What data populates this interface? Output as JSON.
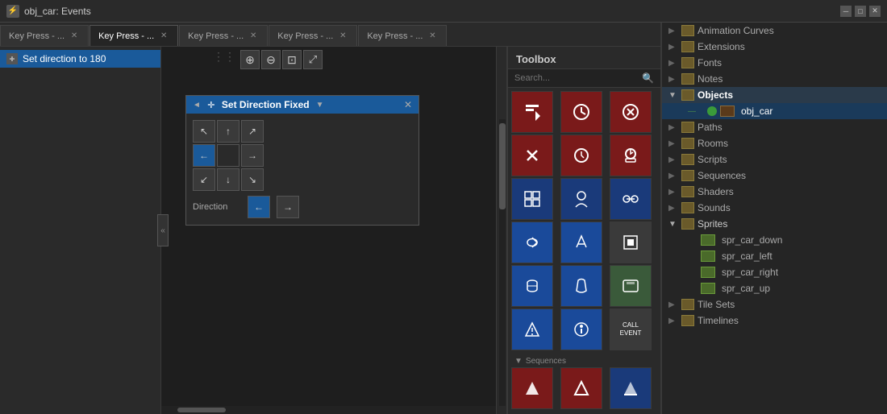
{
  "titleBar": {
    "icon": "⚡",
    "title": "obj_car: Events",
    "minimizeBtn": "─",
    "maximizeBtn": "□",
    "closeBtn": "✕"
  },
  "tabs": [
    {
      "id": 0,
      "label": "Key Press - ...",
      "active": false
    },
    {
      "id": 1,
      "label": "Key Press - ...",
      "active": true
    },
    {
      "id": 2,
      "label": "Key Press - ...",
      "active": false
    },
    {
      "id": 3,
      "label": "Key Press - ...",
      "active": false
    },
    {
      "id": 4,
      "label": "Key Press - ...",
      "active": false
    }
  ],
  "editorToolbar": {
    "dots": "⋮",
    "zoomInLabel": "+",
    "zoomOutLabel": "−",
    "fitLabel": "⊡",
    "fullscreenLabel": "⤢"
  },
  "eventList": [
    {
      "id": 0,
      "label": "Set direction to 180",
      "selected": true,
      "icon": "✛"
    }
  ],
  "canvas": {
    "block": {
      "titleArrow": "◄",
      "titleIcon": "✛",
      "title": "Set Direction Fixed",
      "dropArrow": "▼",
      "closeBtn": "✕",
      "directionLabel": "Direction"
    }
  },
  "toolbox": {
    "title": "Toolbox",
    "searchPlaceholder": "Search...",
    "searchIcon": "🔍",
    "sections": [
      {
        "id": "actions",
        "collapsed": false,
        "tools": [
          {
            "icon": "🚩",
            "color": "dark-red",
            "label": ""
          },
          {
            "icon": "🔄",
            "color": "dark-red",
            "label": ""
          },
          {
            "icon": "⬇",
            "color": "dark-red",
            "label": ""
          },
          {
            "icon": "✂",
            "color": "dark-red",
            "label": ""
          },
          {
            "icon": "⏱",
            "color": "dark-red",
            "label": ""
          },
          {
            "icon": "⏰",
            "color": "dark-red",
            "label": ""
          },
          {
            "icon": "⊞",
            "color": "dark-blue",
            "label": ""
          },
          {
            "icon": "👤",
            "color": "dark-blue",
            "label": ""
          },
          {
            "icon": "⚡",
            "color": "dark-blue",
            "label": ""
          },
          {
            "icon": "➡",
            "color": "medium-blue",
            "label": ""
          },
          {
            "icon": "🐾",
            "color": "medium-blue",
            "label": ""
          },
          {
            "icon": "⬛",
            "color": "gray",
            "label": ""
          },
          {
            "icon": "⚙",
            "color": "medium-blue",
            "label": ""
          },
          {
            "icon": "🐍",
            "color": "medium-blue",
            "label": ""
          },
          {
            "icon": "❓",
            "color": "medium-blue",
            "label": ""
          },
          {
            "icon": "↩",
            "color": "medium-blue",
            "label": ""
          },
          {
            "icon": "⊙",
            "color": "medium-blue",
            "label": ""
          },
          {
            "icon": "CALL\nEVENT",
            "color": "gray",
            "label": "CALL\nEVENT"
          }
        ]
      },
      {
        "id": "sequences",
        "label": "Sequences",
        "collapsed": false,
        "tools": [
          {
            "icon": "▲",
            "color": "dark-red",
            "label": ""
          },
          {
            "icon": "▲",
            "color": "dark-red",
            "label": ""
          },
          {
            "icon": "▲",
            "color": "dark-blue",
            "label": ""
          }
        ]
      }
    ]
  },
  "assetTree": {
    "items": [
      {
        "type": "folder",
        "label": "Animation Curves",
        "indent": 0,
        "expanded": false
      },
      {
        "type": "folder",
        "label": "Extensions",
        "indent": 0,
        "expanded": false
      },
      {
        "type": "folder",
        "label": "Fonts",
        "indent": 0,
        "expanded": false
      },
      {
        "type": "folder",
        "label": "Notes",
        "indent": 0,
        "expanded": false
      },
      {
        "type": "folder",
        "label": "Objects",
        "indent": 0,
        "expanded": true,
        "selected": false
      },
      {
        "type": "object",
        "label": "obj_car",
        "indent": 1,
        "active": true
      },
      {
        "type": "folder",
        "label": "Paths",
        "indent": 0,
        "expanded": false
      },
      {
        "type": "folder",
        "label": "Rooms",
        "indent": 0,
        "expanded": false
      },
      {
        "type": "folder",
        "label": "Scripts",
        "indent": 0,
        "expanded": false
      },
      {
        "type": "folder",
        "label": "Sequences",
        "indent": 0,
        "expanded": false
      },
      {
        "type": "folder",
        "label": "Shaders",
        "indent": 0,
        "expanded": false
      },
      {
        "type": "folder",
        "label": "Sounds",
        "indent": 0,
        "expanded": false
      },
      {
        "type": "folder",
        "label": "Sprites",
        "indent": 0,
        "expanded": true
      },
      {
        "type": "sprite",
        "label": "spr_car_down",
        "indent": 1
      },
      {
        "type": "sprite",
        "label": "spr_car_left",
        "indent": 1
      },
      {
        "type": "sprite",
        "label": "spr_car_right",
        "indent": 1
      },
      {
        "type": "sprite",
        "label": "spr_car_up",
        "indent": 1
      },
      {
        "type": "folder",
        "label": "Tile Sets",
        "indent": 0,
        "expanded": false
      },
      {
        "type": "folder",
        "label": "Timelines",
        "indent": 0,
        "expanded": false
      }
    ]
  }
}
